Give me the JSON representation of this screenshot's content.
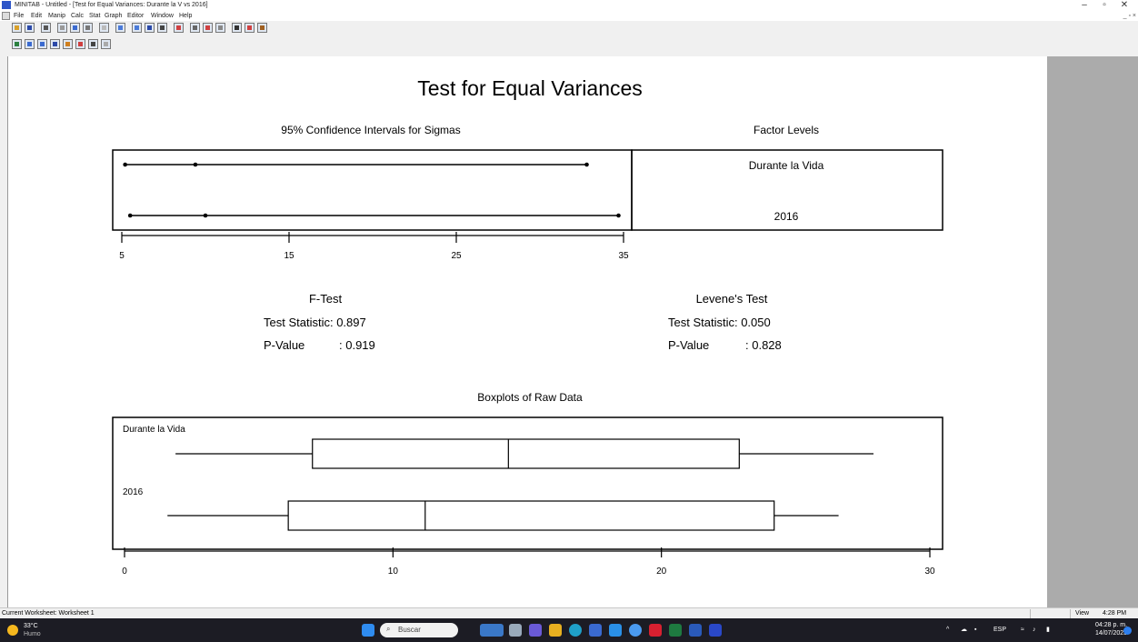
{
  "window": {
    "title": "MINITAB - Untitled - [Test for Equal Variances: Durante la V vs 2016]"
  },
  "window_controls": {
    "minimize": "–",
    "maximize": "▫",
    "close": "✕"
  },
  "mdi_controls": "_ ▫ ×",
  "menu": [
    "File",
    "Edit",
    "Manip",
    "Calc",
    "Stat",
    "Graph",
    "Editor",
    "Window",
    "Help"
  ],
  "graph": {
    "title": "Test for Equal Variances",
    "ci_title": "95% Confidence Intervals for Sigmas",
    "factor_title": "Factor Levels",
    "factor_levels": [
      "Durante la Vida",
      "2016"
    ],
    "ci_ticks": [
      "5",
      "15",
      "25",
      "35"
    ],
    "ftest": {
      "title": "F-Test",
      "stat": "Test Statistic: 0.897",
      "pval_label": "P-Value",
      "pval": ": 0.919"
    },
    "levene": {
      "title": "Levene's Test",
      "stat": "Test Statistic: 0.050",
      "pval_label": "P-Value",
      "pval": ": 0.828"
    },
    "box_title": "Boxplots of Raw Data",
    "box_labels": [
      "Durante la Vida",
      "2016"
    ],
    "box_ticks": [
      "0",
      "10",
      "20",
      "30"
    ]
  },
  "chart_data": [
    {
      "type": "interval",
      "title": "95% Confidence Intervals for Sigmas",
      "xlim": [
        5,
        35
      ],
      "ticks": [
        5,
        15,
        25,
        35
      ],
      "series": [
        {
          "name": "Durante la Vida",
          "lower": 5.2,
          "point": 9.4,
          "upper": 32.8
        },
        {
          "name": "2016",
          "lower": 5.5,
          "point": 10.0,
          "upper": 34.7
        }
      ]
    },
    {
      "type": "boxplot",
      "title": "Boxplots of Raw Data",
      "xlim": [
        0,
        30
      ],
      "ticks": [
        0,
        10,
        20,
        30
      ],
      "series": [
        {
          "name": "Durante la Vida",
          "min": 1.9,
          "q1": 7.0,
          "median": 14.3,
          "q3": 22.9,
          "max": 27.9
        },
        {
          "name": "2016",
          "min": 1.6,
          "q1": 6.1,
          "median": 11.2,
          "q3": 24.2,
          "max": 26.6
        }
      ]
    }
  ],
  "status": {
    "text": "Current Worksheet: Worksheet 1",
    "view": "View",
    "clock": "4:28 PM"
  },
  "taskbar": {
    "temp": "33°C",
    "weather": "Humo",
    "search_placeholder": "Buscar",
    "lang": "ESP",
    "time": "04:28 p. m.",
    "date": "14/07/2023"
  }
}
